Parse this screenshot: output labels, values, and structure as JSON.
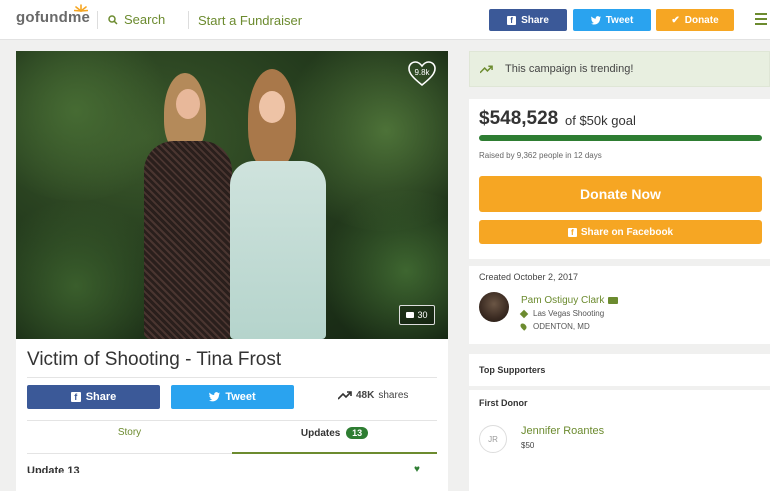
{
  "header": {
    "logo": "gofundme",
    "search_label": "Search",
    "start_label": "Start a Fundraiser",
    "share_label": "Share",
    "tweet_label": "Tweet",
    "donate_label": "Donate"
  },
  "campaign": {
    "likes": "9.8k",
    "photo_count": "30",
    "title": "Victim of Shooting - Tina Frost",
    "share_label": "Share",
    "tweet_label": "Tweet",
    "shares_count": "48K",
    "shares_label": "shares",
    "tab_story": "Story",
    "tab_updates": "Updates",
    "updates_count": "13",
    "update_heading": "Update 13"
  },
  "sidebar": {
    "trending": "This campaign is trending!",
    "raised_amount": "$548,528",
    "goal_text": "of $50k goal",
    "progress_fraction": 1.0,
    "raised_by": "Raised by 9,362 people in 12 days",
    "donate_now": "Donate Now",
    "share_facebook": "Share on Facebook",
    "created": "Created October 2, 2017",
    "organizer_name": "Pam Ostiguy Clark",
    "category": "Las Vegas Shooting",
    "location": "ODENTON, MD",
    "top_supporters": "Top Supporters",
    "first_donor_heading": "First Donor",
    "donor_initials": "JR",
    "donor_name": "Jennifer Roantes",
    "donor_amount": "$50"
  },
  "colors": {
    "brand_green": "#6c8b2f",
    "facebook": "#3b5998",
    "twitter": "#2aa3ef",
    "donate_orange": "#f6a623",
    "progress_green": "#2e7d32"
  }
}
